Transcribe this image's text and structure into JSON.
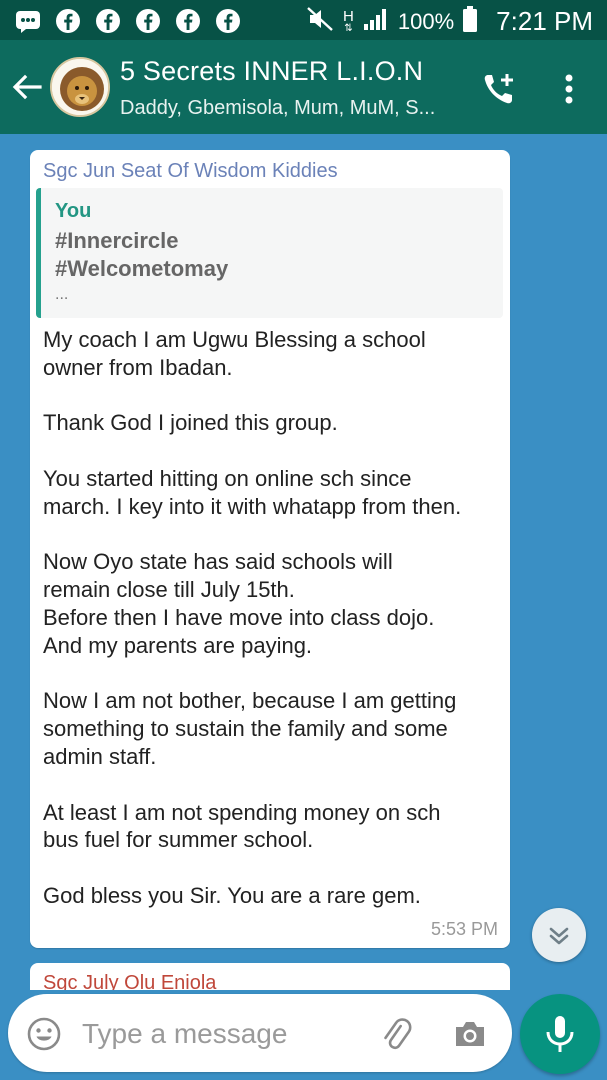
{
  "status_bar": {
    "notification_icons": [
      "bbm-icon",
      "facebook-icon",
      "facebook-icon",
      "facebook-icon",
      "facebook-icon",
      "facebook-icon"
    ],
    "network_label": "H",
    "battery": "100%",
    "time": "7:21 PM"
  },
  "header": {
    "title": "5 Secrets INNER L.I.O.N",
    "subtitle": "Daddy, Gbemisola, Mum, MuM, S..."
  },
  "message": {
    "sender": "Sgc Jun Seat Of Wisdom Kiddies",
    "quote": {
      "author": "You",
      "line1": "#Innercircle",
      "line2": "#Welcometomay",
      "more": "..."
    },
    "paragraphs": [
      "My coach I am Ugwu Blessing a school\nowner from Ibadan.",
      "Thank God I joined this group.",
      "You started hitting on online sch since\nmarch. I key into it with whatapp from then.",
      "Now Oyo state has said schools will\nremain close till July 15th.\nBefore then I have move into class dojo.\nAnd my parents are paying.",
      "Now I am not bother, because I am getting\nsomething to sustain the family and some\nadmin staff.",
      "At least I am not spending money on sch\nbus fuel for summer school.",
      "God bless you Sir. You are a rare gem."
    ],
    "time": "5:53 PM"
  },
  "next_message": {
    "sender": "Sgc July Olu Eniola"
  },
  "input": {
    "placeholder": "Type a message"
  },
  "colors": {
    "status_bar": "#075246",
    "header": "#0d6b5e",
    "chat_background": "#3a8fc4",
    "accent": "#079380",
    "sender": "#6b82b8",
    "quote_author": "#239683"
  }
}
